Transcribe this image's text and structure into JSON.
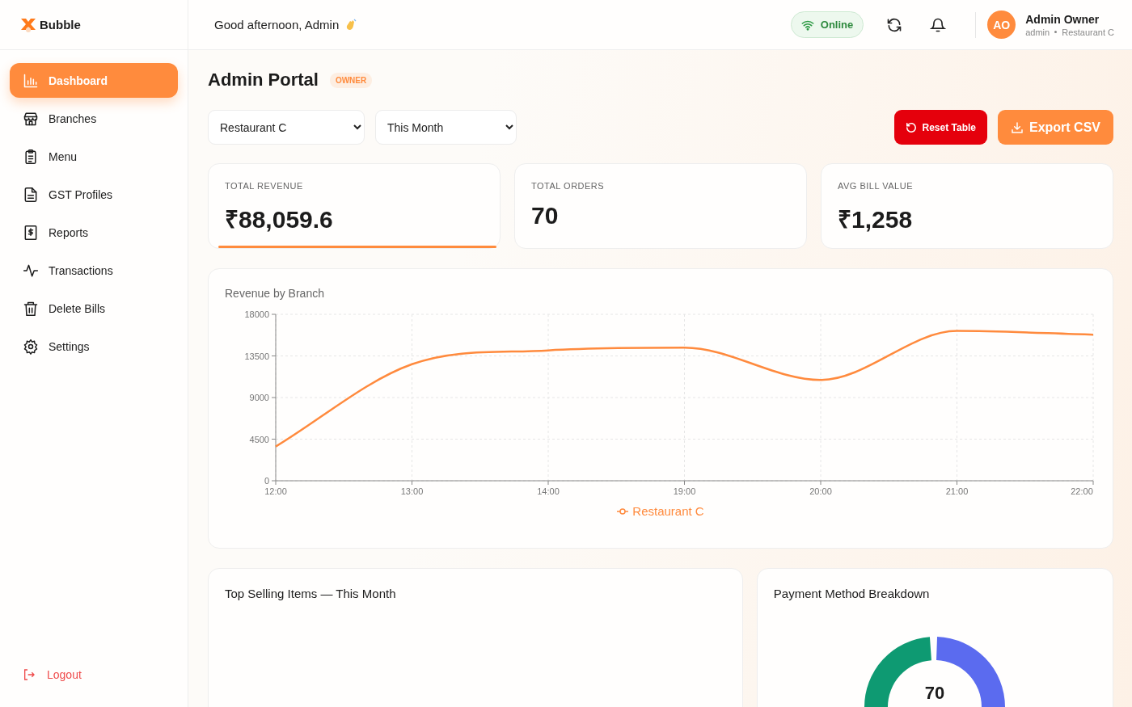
{
  "brand": {
    "name": "Bubble"
  },
  "sidebar": {
    "items": [
      {
        "label": "Dashboard",
        "selected": true,
        "kind": "chart"
      },
      {
        "label": "Branches",
        "selected": false,
        "kind": "store"
      },
      {
        "label": "Menu",
        "selected": false,
        "kind": "clipboard"
      },
      {
        "label": "GST Profiles",
        "selected": false,
        "kind": "file"
      },
      {
        "label": "Reports",
        "selected": false,
        "kind": "receipt"
      },
      {
        "label": "Transactions",
        "selected": false,
        "kind": "activity"
      },
      {
        "label": "Delete Bills",
        "selected": false,
        "kind": "trash"
      },
      {
        "label": "Settings",
        "selected": false,
        "kind": "gear"
      }
    ],
    "logout": "Logout"
  },
  "header": {
    "greeting": "Good afternoon, Admin",
    "status": "Online",
    "user": {
      "initials": "AO",
      "name": "Admin Owner",
      "role": "admin",
      "branch": "Restaurant C"
    }
  },
  "page": {
    "title": "Admin Portal",
    "badge": "OWNER"
  },
  "filters": [
    {
      "value": "Restaurant C"
    },
    {
      "value": "This Month"
    }
  ],
  "actions": [
    {
      "label": "Reset Table",
      "kind": "reset"
    },
    {
      "label": "Export CSV",
      "kind": "export"
    }
  ],
  "stats": [
    {
      "label": "TOTAL REVENUE",
      "value": "₹88,059.6",
      "selected": true
    },
    {
      "label": "TOTAL ORDERS",
      "value": "70",
      "selected": false
    },
    {
      "label": "AVG BILL VALUE",
      "value": "₹1,258",
      "selected": false
    }
  ],
  "revenue_chart": {
    "title": "Revenue by Branch",
    "chart_data": {
      "type": "line",
      "categories": [
        "12:00",
        "13:00",
        "14:00",
        "19:00",
        "20:00",
        "21:00",
        "22:00"
      ],
      "series": [
        {
          "name": "Restaurant C",
          "color": "#ff8a3d",
          "values": [
            3700,
            12600,
            14100,
            14400,
            10900,
            16200,
            15800
          ]
        }
      ],
      "ylim": [
        0,
        18000
      ],
      "grid": true,
      "yticks": [
        0,
        4500,
        9000,
        13500,
        18000
      ]
    }
  },
  "top_items": {
    "title": "Top Selling Items — This Month"
  },
  "payments": {
    "title": "Payment Method Breakdown",
    "center_value": "70"
  }
}
